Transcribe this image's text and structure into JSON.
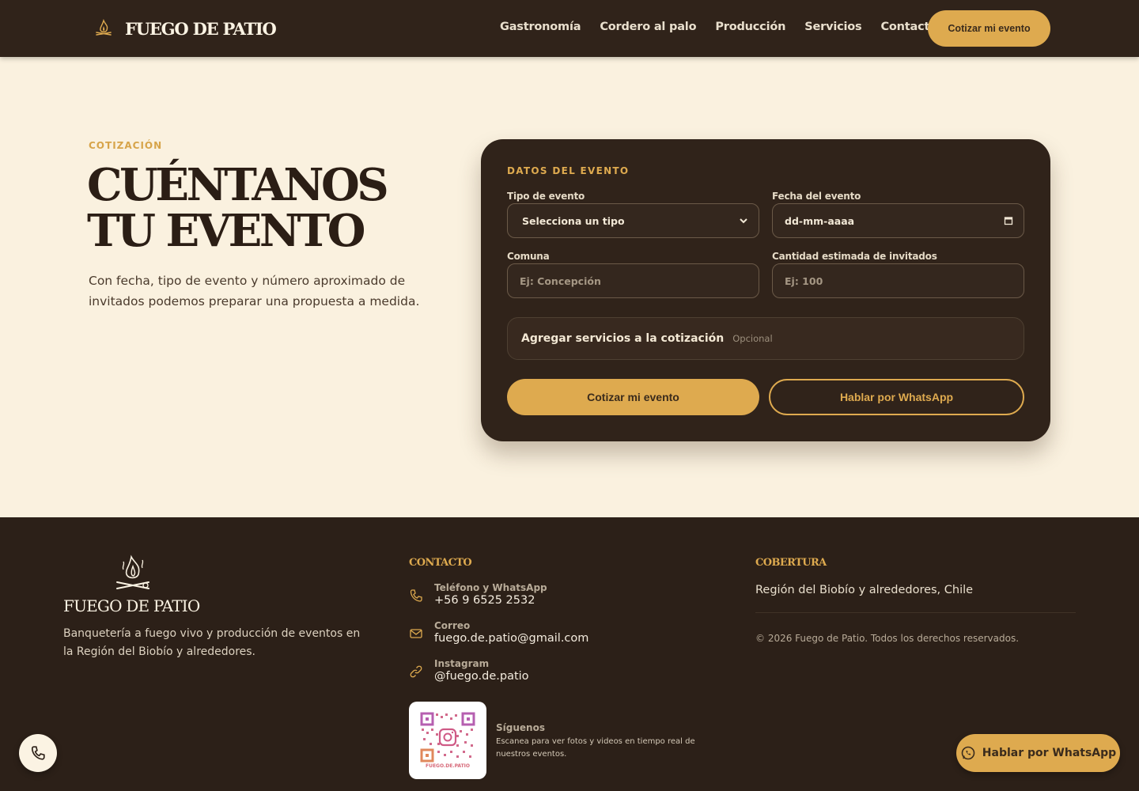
{
  "header": {
    "brand_name": "FUEGO DE PATIO",
    "nav": [
      "Gastronomía",
      "Cordero al palo",
      "Producción",
      "Servicios",
      "Contacto"
    ],
    "cta_label": "Cotizar mi evento"
  },
  "hero": {
    "eyebrow": "COTIZACIÓN",
    "title_line1": "CUÉNTANOS",
    "title_line2": "TU EVENTO",
    "description": "Con fecha, tipo de evento y número aproximado de invitados podemos preparar una propuesta a medida."
  },
  "form": {
    "title": "DATOS DEL EVENTO",
    "event_type": {
      "label": "Tipo de evento",
      "value": "Selecciona un tipo"
    },
    "event_date": {
      "label": "Fecha del evento",
      "value": "dd-mm-aaaa"
    },
    "commune": {
      "label": "Comuna",
      "placeholder": "Ej: Concepción"
    },
    "guests": {
      "label": "Cantidad estimada de invitados",
      "placeholder": "Ej: 100"
    },
    "addon": {
      "title": "Agregar servicios a la cotización",
      "optional": "Opcional"
    },
    "submit_label": "Cotizar mi evento",
    "whatsapp_label": "Hablar por WhatsApp"
  },
  "footer": {
    "brand_name": "FUEGO DE PATIO",
    "description": "Banquetería a fuego vivo y producción de eventos en la Región del Biobío y alrededores.",
    "contact_heading": "CONTACTO",
    "contacts": [
      {
        "label": "Teléfono y WhatsApp",
        "value": "+56 9 6525 2532"
      },
      {
        "label": "Correo",
        "value": "fuego.de.patio@gmail.com"
      },
      {
        "label": "Instagram",
        "value": "@fuego.de.patio"
      }
    ],
    "qr_caption": "FUEGO.DE.PATIO",
    "follow_title": "Síguenos",
    "follow_text": "Escanea para ver fotos y videos en tiempo real de nuestros eventos.",
    "coverage_heading": "COBERTURA",
    "coverage_text": "Región del Biobío y alrededores, Chile",
    "copyright": "© 2026 Fuego de Patio. Todos los derechos reservados."
  },
  "floating": {
    "whatsapp_label": "Hablar por WhatsApp"
  },
  "colors": {
    "dark": "#30231a",
    "accent": "#deaa4f",
    "cream": "#faf1df"
  }
}
